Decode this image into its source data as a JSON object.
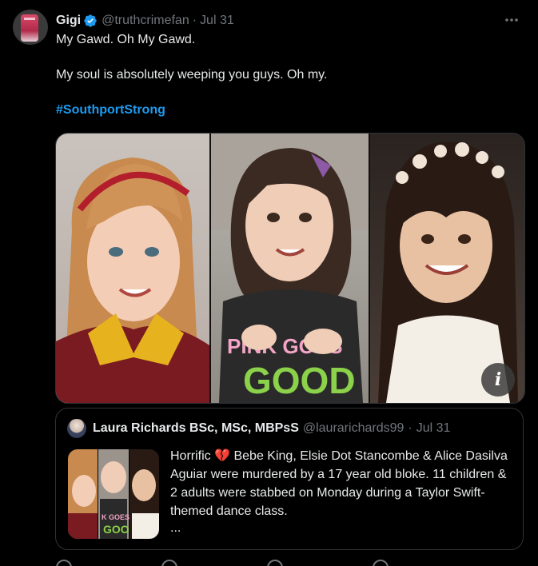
{
  "tweet": {
    "display_name": "Gigi",
    "handle": "@truthcrimefan",
    "separator": "·",
    "date": "Jul 31",
    "lines": [
      "My Gawd. Oh My Gawd.",
      "My soul is absolutely weeping you guys. Oh my."
    ],
    "hashtag": "#SouthportStrong",
    "info_button": "i"
  },
  "quote": {
    "display_name": "Laura Richards BSc, MSc, MBPsS",
    "handle": "@laurarichards99",
    "separator": "·",
    "date": "Jul 31",
    "text_before": "Horrific ",
    "emoji": "💔",
    "text_after": " Bebe King, Elsie Dot Stancombe & Alice Dasilva Aguiar were murdered by a 17 year old bloke. 11 children & 2 adults were stabbed on Monday during a Taylor Swift-themed dance class.",
    "ellipsis": "..."
  },
  "icons": {
    "verified": "verified-badge-icon",
    "more": "more-options-icon",
    "info": "info-icon"
  },
  "colors": {
    "background": "#000000",
    "text": "#e7e9ea",
    "muted": "#71767b",
    "link": "#1d9bf0",
    "border": "#2f3336",
    "heart": "#f4212e"
  },
  "media_text": {
    "shirt": "PINK GOES GOOD"
  }
}
